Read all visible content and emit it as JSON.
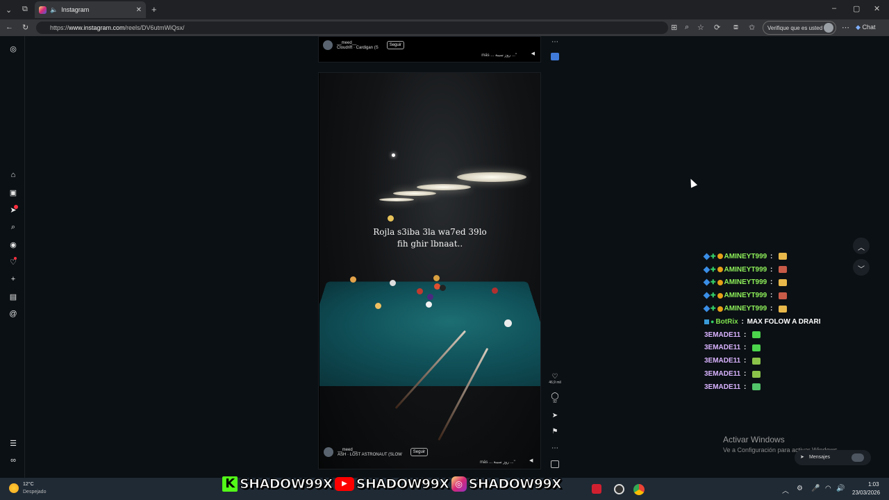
{
  "browser": {
    "tab_title": "Instagram",
    "url_prefix": "https://",
    "url_host": "www.instagram.com",
    "url_path": "/reels/DV6utmWiQsx/",
    "verify_label": "Verifique que es usted",
    "chat_label": "Chat"
  },
  "sidebar": {
    "icons": [
      "instagram-icon",
      "home-icon",
      "reels-icon",
      "direct-icon",
      "search-icon",
      "explore-icon",
      "heart-icon",
      "create-icon",
      "dashboard-icon",
      "threads-icon",
      "menu-icon",
      "meta-icon"
    ]
  },
  "reel_top": {
    "username": "__meed__",
    "audio": "Cloudrift · Cardigan (S",
    "follow": "Seguir",
    "more": "más ... روز سيبة ...\""
  },
  "reel_main": {
    "caption_line1": "Rojla s3iba 3la wa7ed 39lo",
    "caption_line2": "fih ghir lbnaat..",
    "username": "__meed__",
    "audio": "ASH · LOST ASTRONAUT (SLOW",
    "follow": "Seguir",
    "more": "más ... روز سيبة ...\"",
    "likes": "46,9 mil",
    "comments": "92"
  },
  "stream_chat": [
    {
      "user": "AMINEYT999",
      "badges": true,
      "style": "a",
      "message": "",
      "emote_color": "#e8b84a"
    },
    {
      "user": "AMINEYT999",
      "badges": true,
      "style": "a",
      "message": "",
      "emote_color": "#c85a48"
    },
    {
      "user": "AMINEYT999",
      "badges": true,
      "style": "a",
      "message": "",
      "emote_color": "#e8b84a"
    },
    {
      "user": "AMINEYT999",
      "badges": true,
      "style": "a",
      "message": "",
      "emote_color": "#c85a48"
    },
    {
      "user": "AMINEYT999",
      "badges": true,
      "style": "a",
      "message": "",
      "emote_color": "#e8b84a"
    },
    {
      "user": "BotRix",
      "badges": true,
      "style": "b",
      "message": "MAX FOLOW A DRARI",
      "emote_color": ""
    },
    {
      "user": "3EMADE11",
      "badges": false,
      "style": "c",
      "message": "",
      "emote_color": "#4cd44c"
    },
    {
      "user": "3EMADE11",
      "badges": false,
      "style": "c",
      "message": "",
      "emote_color": "#4cd44c"
    },
    {
      "user": "3EMADE11",
      "badges": false,
      "style": "c",
      "message": "",
      "emote_color": "#8bc34a"
    },
    {
      "user": "3EMADE11",
      "badges": false,
      "style": "c",
      "message": "",
      "emote_color": "#8bc34a"
    },
    {
      "user": "3EMADE11",
      "badges": false,
      "style": "c",
      "message": "",
      "emote_color": "#52c46a"
    }
  ],
  "overlay": {
    "activate_title": "Activar Windows",
    "activate_sub": "Ve a Configuración para activar Windows.",
    "messages": "Mensajes"
  },
  "taskbar": {
    "temp": "12°C",
    "weather": "Despejado",
    "banner_text": "SHADOW99X",
    "time": "1:03",
    "date": "23/03/2026"
  }
}
